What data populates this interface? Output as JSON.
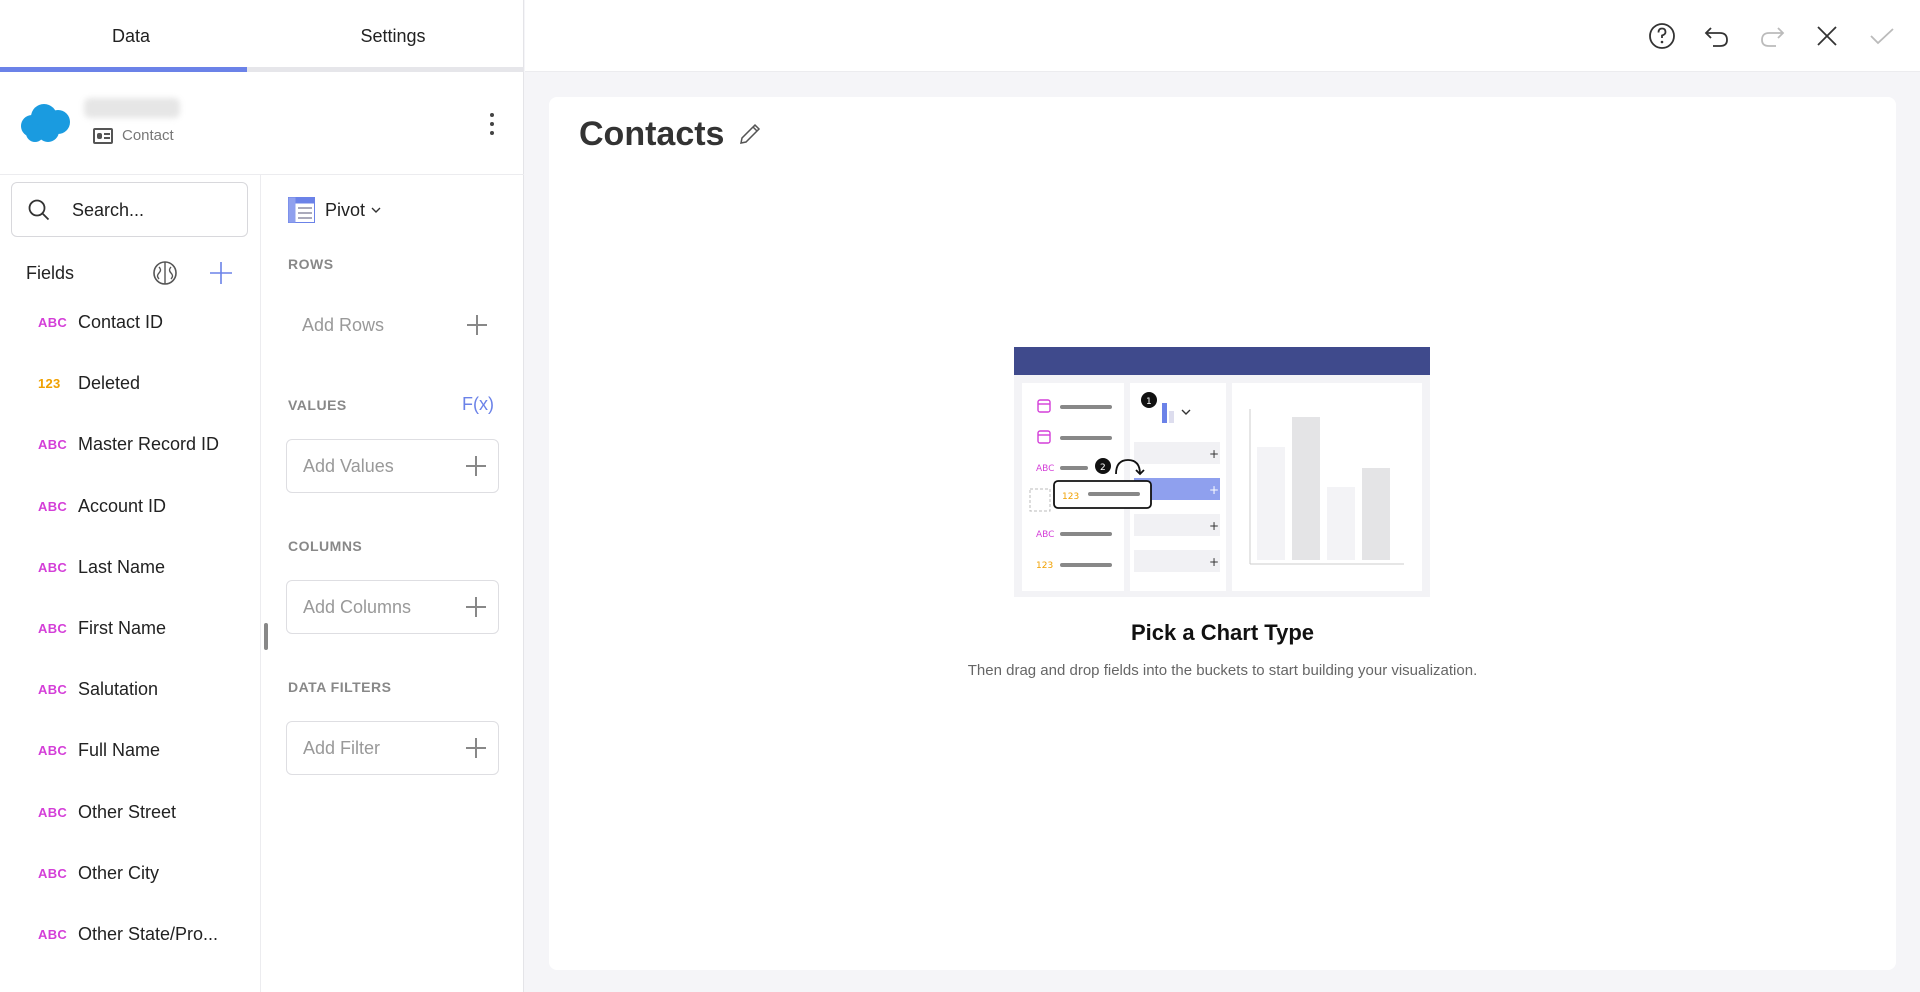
{
  "tabs": {
    "data": "Data",
    "settings": "Settings"
  },
  "source": {
    "subtitle": "Contact"
  },
  "search": {
    "placeholder": "Search..."
  },
  "fields_panel": {
    "title": "Fields",
    "items": [
      {
        "type": "ABC",
        "label": "Contact ID"
      },
      {
        "type": "123",
        "label": "Deleted"
      },
      {
        "type": "ABC",
        "label": "Master Record ID"
      },
      {
        "type": "ABC",
        "label": "Account ID"
      },
      {
        "type": "ABC",
        "label": "Last Name"
      },
      {
        "type": "ABC",
        "label": "First Name"
      },
      {
        "type": "ABC",
        "label": "Salutation"
      },
      {
        "type": "ABC",
        "label": "Full Name"
      },
      {
        "type": "ABC",
        "label": "Other Street"
      },
      {
        "type": "ABC",
        "label": "Other City"
      },
      {
        "type": "ABC",
        "label": "Other State/Pro..."
      }
    ]
  },
  "buckets": {
    "visualization": "Pivot",
    "rows_title": "ROWS",
    "rows_add": "Add Rows",
    "values_title": "VALUES",
    "fx": "F(x)",
    "values_add": "Add Values",
    "columns_title": "COLUMNS",
    "columns_add": "Add Columns",
    "filters_title": "DATA FILTERS",
    "filters_add": "Add Filter"
  },
  "canvas": {
    "title": "Contacts",
    "pick_title": "Pick a Chart Type",
    "pick_subtitle": "Then drag and drop fields into the buckets to start building your visualization.",
    "illustration": {
      "badge1": "1",
      "badge2": "2",
      "abc": "ABC",
      "num": "123"
    }
  },
  "colors": {
    "accent": "#6b82e8",
    "abc": "#d43fd8",
    "num": "#f0a000",
    "header_bar": "#3f4a8c"
  }
}
